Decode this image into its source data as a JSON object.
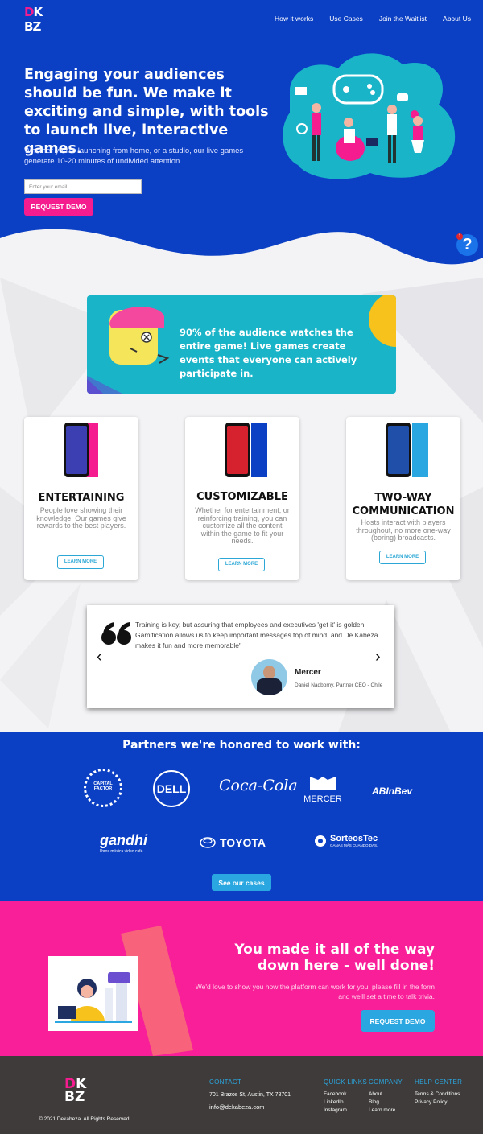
{
  "brand": {
    "logo_text": [
      "D",
      "K",
      "B",
      "Z"
    ]
  },
  "nav": {
    "items": [
      "How it works",
      "Use Cases",
      "Join the Waitlist",
      "About Us"
    ]
  },
  "hero": {
    "headline": "Engaging your audiences should be fun. We make it exciting and simple, with tools to launch live, interactive games.",
    "subtext": "Whether you're launching from home, or a studio, our live games generate 10-20 minutes of undivided attention.",
    "email_placeholder": "Enter your email",
    "cta_label": "REQUEST DEMO"
  },
  "help": {
    "badge": "1",
    "icon": "?"
  },
  "stat": {
    "text": "90% of the audience watches the entire game! Live games create events that everyone can actively participate in."
  },
  "features": [
    {
      "title": "ENTERTAINING",
      "desc": "People love showing their knowledge. Our games give rewards to the best players.",
      "button": "LEARN MORE"
    },
    {
      "title": "CUSTOMIZABLE",
      "desc": "Whether for entertainment, or reinforcing training, you can customize all the content within the game to fit your needs.",
      "button": "LEARN MORE"
    },
    {
      "title": "TWO-WAY COMMUNICATION",
      "desc": "Hosts interact with players throughout, no more one-way (boring) broadcasts.",
      "button": "LEARN MORE"
    }
  ],
  "testimonial": {
    "quote": "Training is key, but assuring that employees and executives 'get it' is golden. Gamification allows us to keep important messages top of mind, and De Kabeza makes it fun and more memorable\"",
    "name": "Mercer",
    "role": "Daniel Nadborny, Partner CEO - Chile"
  },
  "partners": {
    "heading": "Partners we're honored to work with:",
    "logos": [
      "CAPITAL FACTOR",
      "DELL",
      "Coca-Cola",
      "MERCER",
      "ABInBev",
      "gandhi",
      "TOYOTA",
      "SorteosTec"
    ],
    "gandhi_tag": "libros música video café",
    "sorteos_tag": "GANAS MÁS CUANDO DAS.",
    "button": "See our cases"
  },
  "cta": {
    "heading": "You made it all of the way down here - well done!",
    "text": "We'd love to show you how the platform can work for you, please fill in the form and we'll set a time to talk trivia.",
    "button": "REQUEST DEMO"
  },
  "footer": {
    "contact_heading": "CONTACT",
    "address": "701 Brazos St, Austin, TX 78701",
    "email": "info@dekabeza.com",
    "quick_heading": "QUICK LINKS",
    "quick_links": [
      "Facebook",
      "LinkedIn",
      "Instagram"
    ],
    "company_heading": "COMPANY",
    "company_links": [
      "About",
      "Blog",
      "Learn more"
    ],
    "help_heading": "HELP CENTER",
    "help_links": [
      "Terms & Conditions",
      "Privacy Policy"
    ],
    "copyright": "© 2021 Dekabeza. All Rights Reserved"
  },
  "colors": {
    "primary_blue": "#0b3fc4",
    "pink": "#f41c8e",
    "teal": "#1ab4c8",
    "light_blue": "#2aa7e0"
  }
}
